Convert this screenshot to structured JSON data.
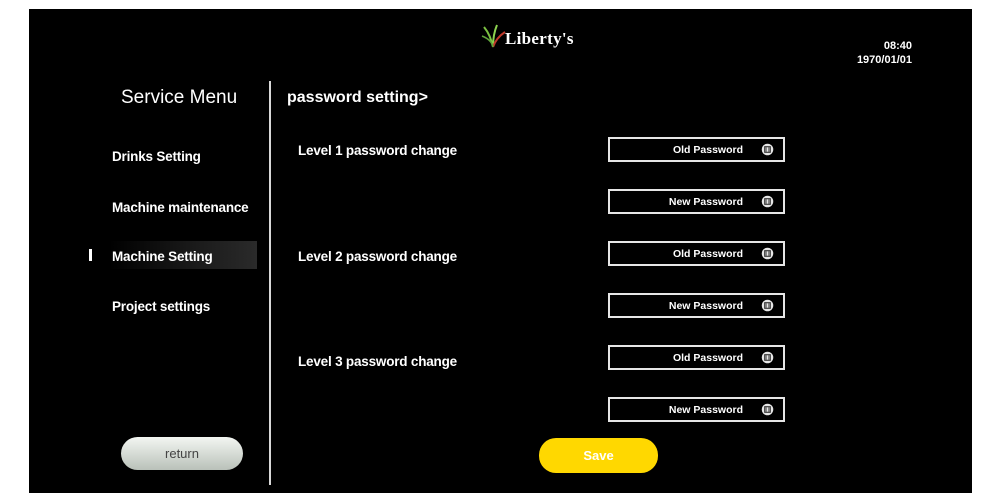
{
  "header": {
    "brand": "Liberty's",
    "time": "08:40",
    "date": "1970/01/01"
  },
  "sidebar": {
    "title": "Service Menu",
    "items": [
      {
        "label": "Drinks Setting"
      },
      {
        "label": "Machine maintenance"
      },
      {
        "label": "Machine Setting",
        "selected": true
      },
      {
        "label": "Project settings"
      }
    ],
    "return_label": "return"
  },
  "main": {
    "section_title": "password setting>",
    "levels": [
      {
        "label": "Level 1 password change",
        "old_placeholder": "Old Password",
        "new_placeholder": "New Password"
      },
      {
        "label": "Level 2 password change",
        "old_placeholder": "Old Password",
        "new_placeholder": "New Password"
      },
      {
        "label": "Level 3 password change",
        "old_placeholder": "Old Password",
        "new_placeholder": "New Password"
      }
    ],
    "save_label": "Save"
  },
  "colors": {
    "background": "#000000",
    "text": "#ffffff",
    "save_button": "#ffd800",
    "return_button": "#d9ded8"
  },
  "icons": {
    "brand_logo": "leaf-icon",
    "input_clear": "clear-icon"
  }
}
